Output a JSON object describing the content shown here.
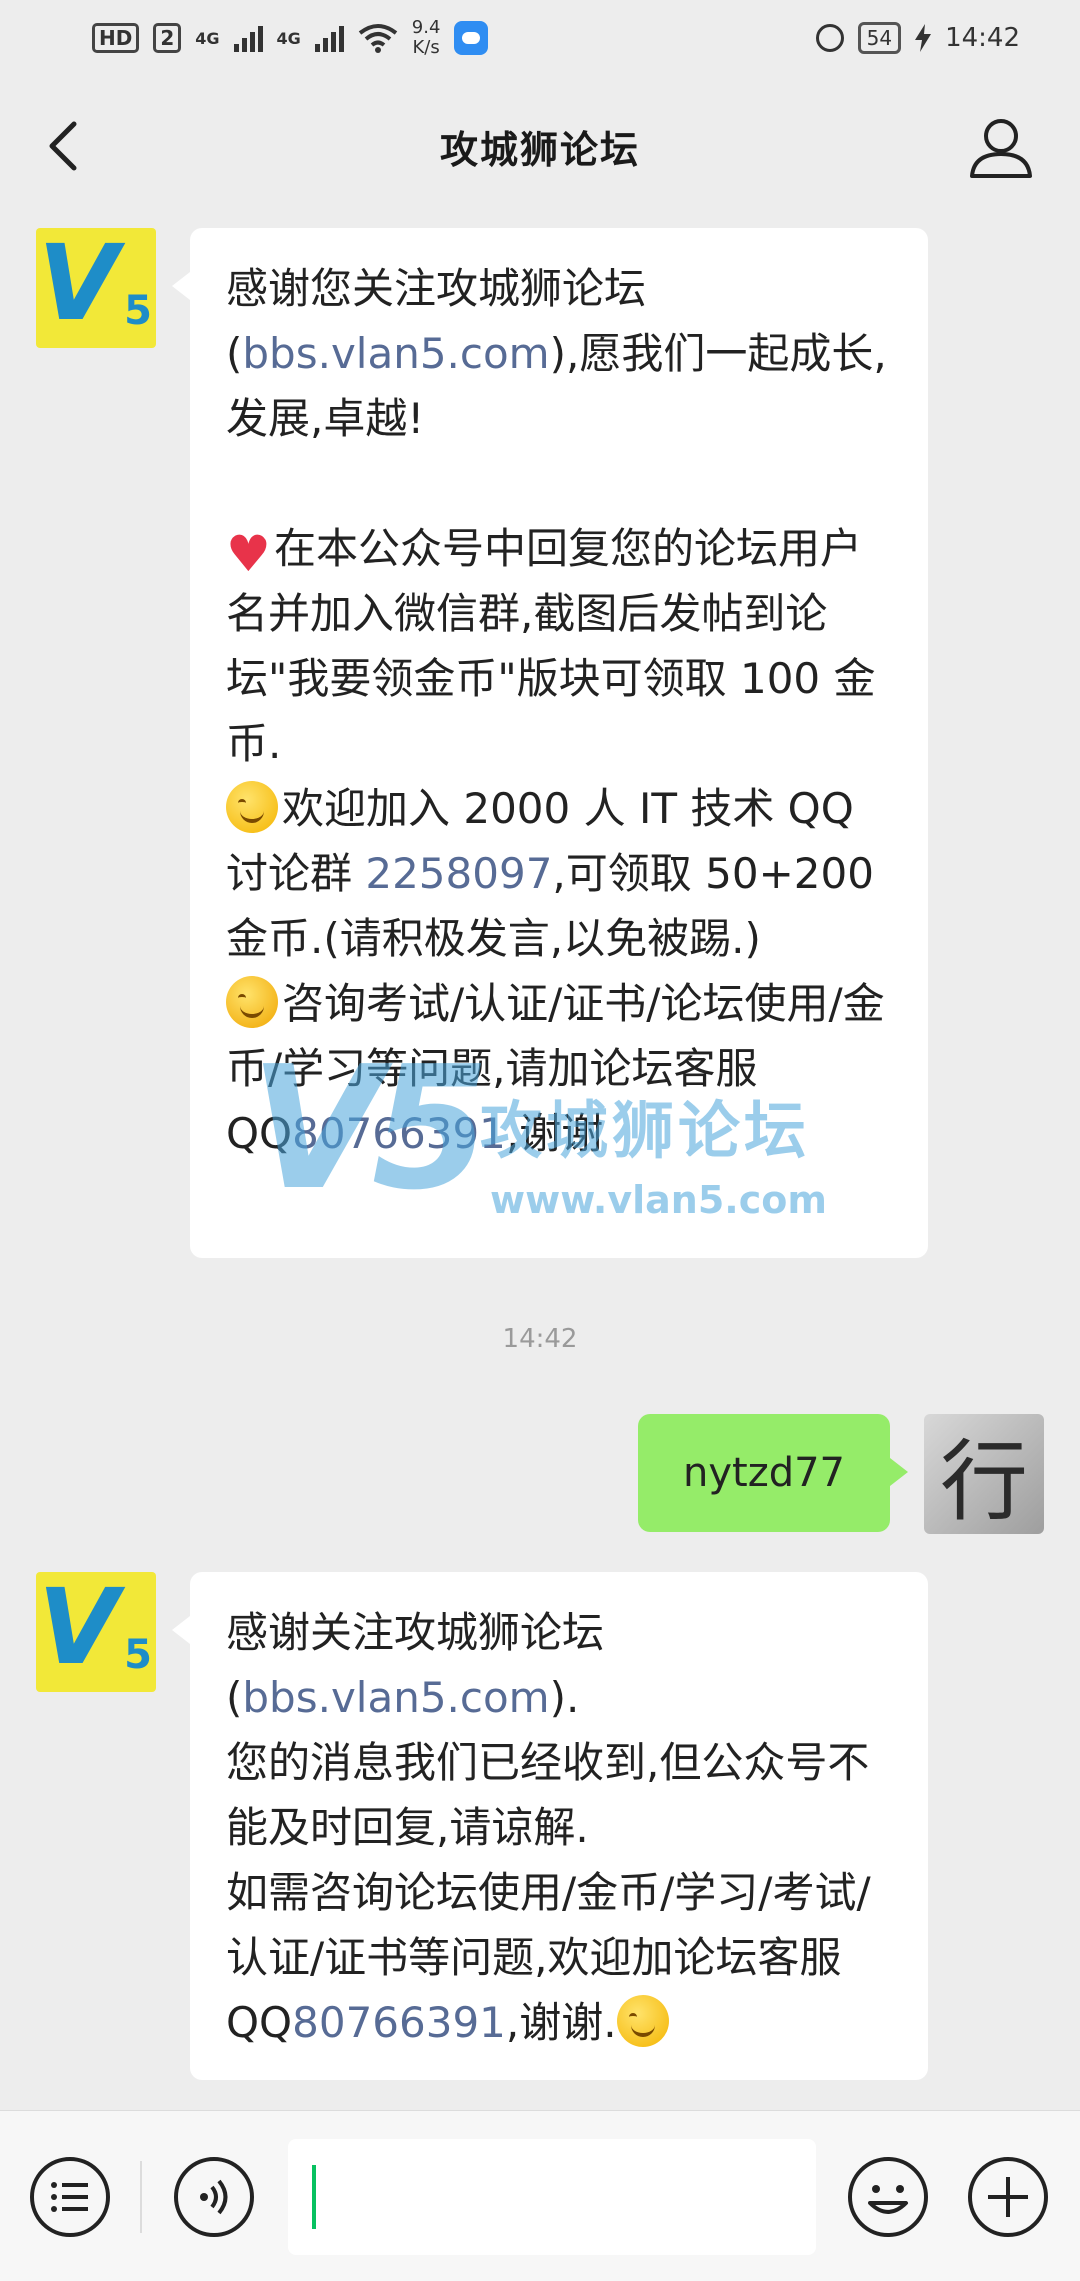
{
  "status_bar": {
    "hd_badge": "HD",
    "sim_slot": "2",
    "net1": "4G",
    "net2": "4G",
    "speed_value": "9.4",
    "speed_unit": "K/s",
    "battery": "54",
    "time": "14:42"
  },
  "nav": {
    "title": "攻城狮论坛",
    "back_icon": "chevron-left-icon",
    "profile_icon": "user-icon"
  },
  "messages": [
    {
      "from": "official",
      "avatar_text": "V5",
      "lines": {
        "p1a": "感谢您关注攻城狮论坛(",
        "p1link": "bbs.vlan5.com",
        "p1b": "),愿我们一起成长,发展,卓越!",
        "p2": "在本公众号中回复您的论坛用户名并加入微信群,截图后发帖到论坛\"我要领金币\"版块可领取 100 金币.",
        "p3a": "欢迎加入 2000 人 IT 技术 QQ 讨论群 ",
        "p3link": "2258097",
        "p3b": ",可领取 50+200 金币.(请积极发言,以免被踢.)",
        "p4a": "咨询考试/认证/证书/论坛使用/金币/学习等问题,请加论坛客服 QQ",
        "p4link": "80766391",
        "p4b": ",谢谢"
      }
    },
    {
      "from": "me",
      "text": "nytzd77",
      "avatar_text": "行"
    },
    {
      "from": "official",
      "avatar_text": "V5",
      "lines": {
        "p1a": "感谢关注攻城狮论坛(",
        "p1link": "bbs.vlan5.com",
        "p1b": ").",
        "p2": "您的消息我们已经收到,但公众号不能及时回复,请谅解.",
        "p3a": "如需咨询论坛使用/金币/学习/考试/认证/证书等问题,欢迎加论坛客服 QQ",
        "p3link": "80766391",
        "p3b": ",谢谢."
      }
    }
  ],
  "timestamp": "14:42",
  "watermark": {
    "logo": "V5",
    "name": "攻城狮论坛",
    "url": "www.vlan5.com"
  },
  "bottom_bar": {
    "menu_icon": "menu-list-icon",
    "voice_icon": "voice-icon",
    "emoji_icon": "emoji-icon",
    "plus_icon": "plus-icon"
  },
  "colors": {
    "background": "#ededed",
    "incoming_bubble": "#ffffff",
    "outgoing_bubble": "#95ec69",
    "link": "#576b95",
    "caret": "#07c160"
  }
}
